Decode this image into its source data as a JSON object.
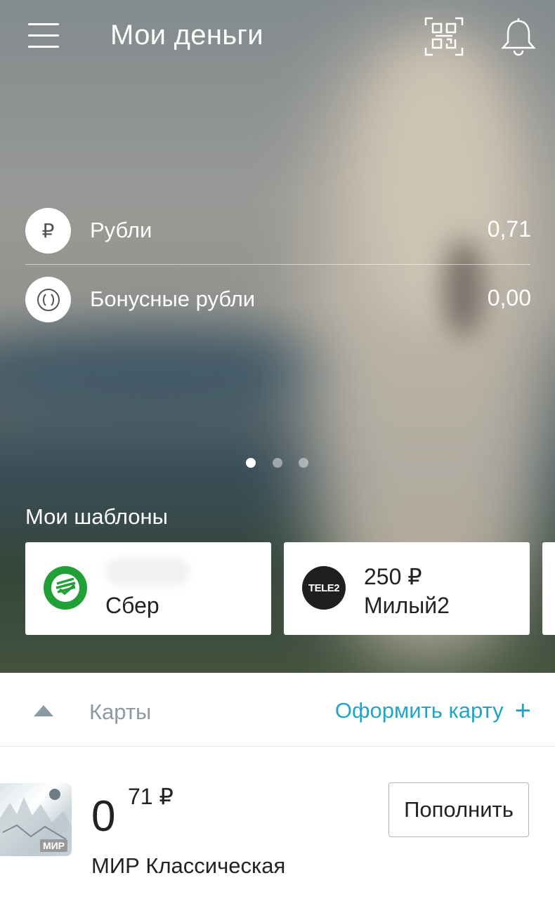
{
  "header": {
    "title": "Мои деньги",
    "menu_icon": "hamburger-menu-icon",
    "qr_icon": "qr-scan-icon",
    "bell_icon": "notification-bell-icon"
  },
  "balances": [
    {
      "icon": "₽",
      "label": "Рубли",
      "value": "0,71"
    },
    {
      "icon": "bonus-icon",
      "label": "Бонусные рубли",
      "value": "0,00"
    }
  ],
  "carousel": {
    "pages": 3,
    "active": 1
  },
  "templates": {
    "title": "Мои шаблоны",
    "items": [
      {
        "logo": "sber-logo",
        "line1": "",
        "line2": "Сбер"
      },
      {
        "logo": "tele2-logo",
        "logo_text": "TELE2",
        "line1": "250 ₽",
        "line2": "Милый2"
      }
    ]
  },
  "cards_section": {
    "label": "Карты",
    "new_card_label": "Оформить карту",
    "plus": "+"
  },
  "card": {
    "amount_int": "0",
    "amount_frac": "71 ₽",
    "topup_label": "Пополнить",
    "name": "МИР Классическая",
    "brand": "МИР"
  },
  "colors": {
    "accent": "#21a4c7",
    "sber_green": "#21a038",
    "tele2_black": "#1f1f1f"
  }
}
